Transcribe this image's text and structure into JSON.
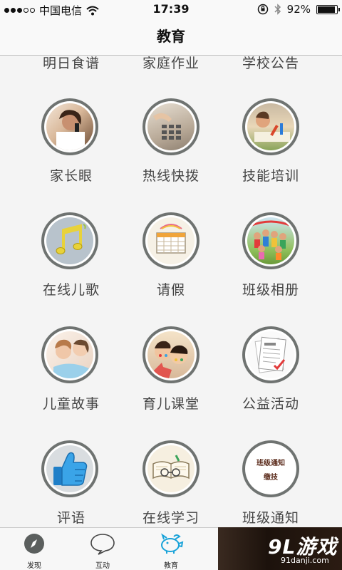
{
  "status": {
    "carrier": "中国电信",
    "time": "17:39",
    "battery": "92%",
    "battery_level": 0.92
  },
  "header": {
    "title": "教育"
  },
  "partial_row": [
    "明日食谱",
    "家庭作业",
    "学校公告"
  ],
  "grid": [
    {
      "label": "家长眼",
      "icon": "parent-phone-photo"
    },
    {
      "label": "热线快拨",
      "icon": "telephone-keypad-photo"
    },
    {
      "label": "技能培训",
      "icon": "child-drawing-photo"
    },
    {
      "label": "在线儿歌",
      "icon": "music-note"
    },
    {
      "label": "请假",
      "icon": "calendar"
    },
    {
      "label": "班级相册",
      "icon": "class-group-photo"
    },
    {
      "label": "儿童故事",
      "icon": "mother-child-photo"
    },
    {
      "label": "育儿课堂",
      "icon": "children-painted-faces-photo"
    },
    {
      "label": "公益活动",
      "icon": "certificate-document"
    },
    {
      "label": "评语",
      "icon": "thumbs-up"
    },
    {
      "label": "在线学习",
      "icon": "book-glasses"
    },
    {
      "label": "班级通知",
      "icon": "notice-card",
      "icon_text": [
        "班级通知",
        "缴技"
      ]
    }
  ],
  "tabbar": [
    {
      "label": "发现",
      "icon": "compass-icon"
    },
    {
      "label": "互动",
      "icon": "chat-bubble-icon"
    },
    {
      "label": "教育",
      "icon": "piggy-icon",
      "active": true
    },
    {
      "label": "",
      "icon": "cart-icon"
    }
  ],
  "watermark": {
    "logo": "9L游戏",
    "url": "91danji.com"
  },
  "colors": {
    "ring": "#6f7371",
    "label": "#444444",
    "active_tab": "#1aa3d9",
    "background": "#f4f4f4"
  }
}
